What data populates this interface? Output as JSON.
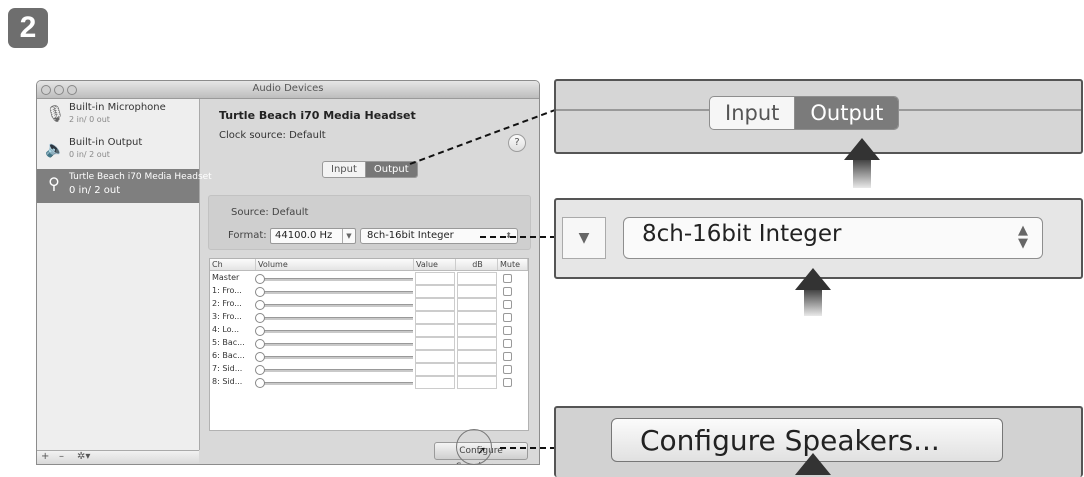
{
  "step": "2",
  "window": {
    "title": "Audio Devices",
    "devices": [
      {
        "name": "Built-in Microphone",
        "io": "2 in/ 0 out",
        "icon": "microphone-icon"
      },
      {
        "name": "Built-in Output",
        "io": "0 in/ 2 out",
        "icon": "speaker-icon"
      },
      {
        "name": "Turtle Beach i70 Media Headset",
        "io": "0 in/ 2 out",
        "icon": "usb-icon",
        "selected": true
      }
    ],
    "toolbar": {
      "add": "+",
      "remove": "–",
      "gear": "✲▾"
    },
    "device_title": "Turtle Beach i70 Media Headset",
    "clock_source": "Clock source:  Default",
    "help": "?",
    "tabs": {
      "input": "Input",
      "output": "Output",
      "active": "output"
    },
    "source_label": "Source:  Default",
    "format_label": "Format:",
    "sample_rate": "44100.0 Hz",
    "format_value": "8ch-16bit Integer",
    "table": {
      "columns": [
        "Ch",
        "Volume",
        "Value",
        "dB",
        "Mute"
      ],
      "rows": [
        "Master",
        "1: Fro...",
        "2: Fro...",
        "3: Fro...",
        "4: Lo...",
        "5: Bac...",
        "6: Bac...",
        "7: Sid...",
        "8: Sid..."
      ]
    },
    "configure_button": "Configure Speakers..."
  },
  "callouts": {
    "tabs": {
      "input": "Input",
      "output": "Output"
    },
    "format": "8ch-16bit Integer",
    "configure": "Configure Speakers..."
  },
  "colors": {
    "selected": "#7f7f7f",
    "active_tab": "#777777",
    "arrow": "#333333"
  }
}
